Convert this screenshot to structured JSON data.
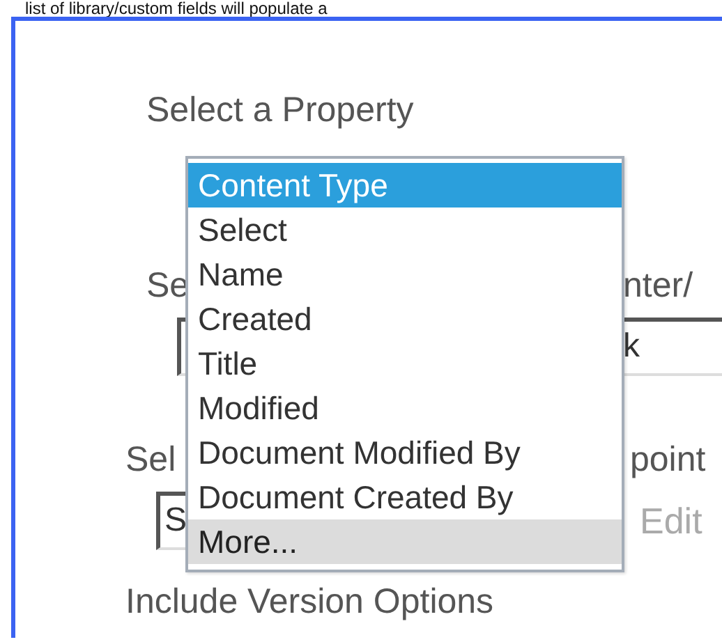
{
  "intro_text": "list of library/custom fields will populate a",
  "panel": {
    "title": "Select a Property",
    "row_1": {
      "label": "Se",
      "label_right": "nter/",
      "field_value": "k"
    },
    "row_2": {
      "label": "Sel",
      "label_right": "point",
      "field_value": "S",
      "link": "Edit"
    },
    "footer_label": "Include Version Options"
  },
  "dropdown": {
    "items": [
      {
        "label": "Content Type",
        "selected": true,
        "hovered": false
      },
      {
        "label": "Select",
        "selected": false,
        "hovered": false
      },
      {
        "label": "Name",
        "selected": false,
        "hovered": false
      },
      {
        "label": "Created",
        "selected": false,
        "hovered": false
      },
      {
        "label": "Title",
        "selected": false,
        "hovered": false
      },
      {
        "label": "Modified",
        "selected": false,
        "hovered": false
      },
      {
        "label": "Document Modified By",
        "selected": false,
        "hovered": false
      },
      {
        "label": "Document Created By",
        "selected": false,
        "hovered": false
      },
      {
        "label": "More...",
        "selected": false,
        "hovered": true
      }
    ]
  }
}
